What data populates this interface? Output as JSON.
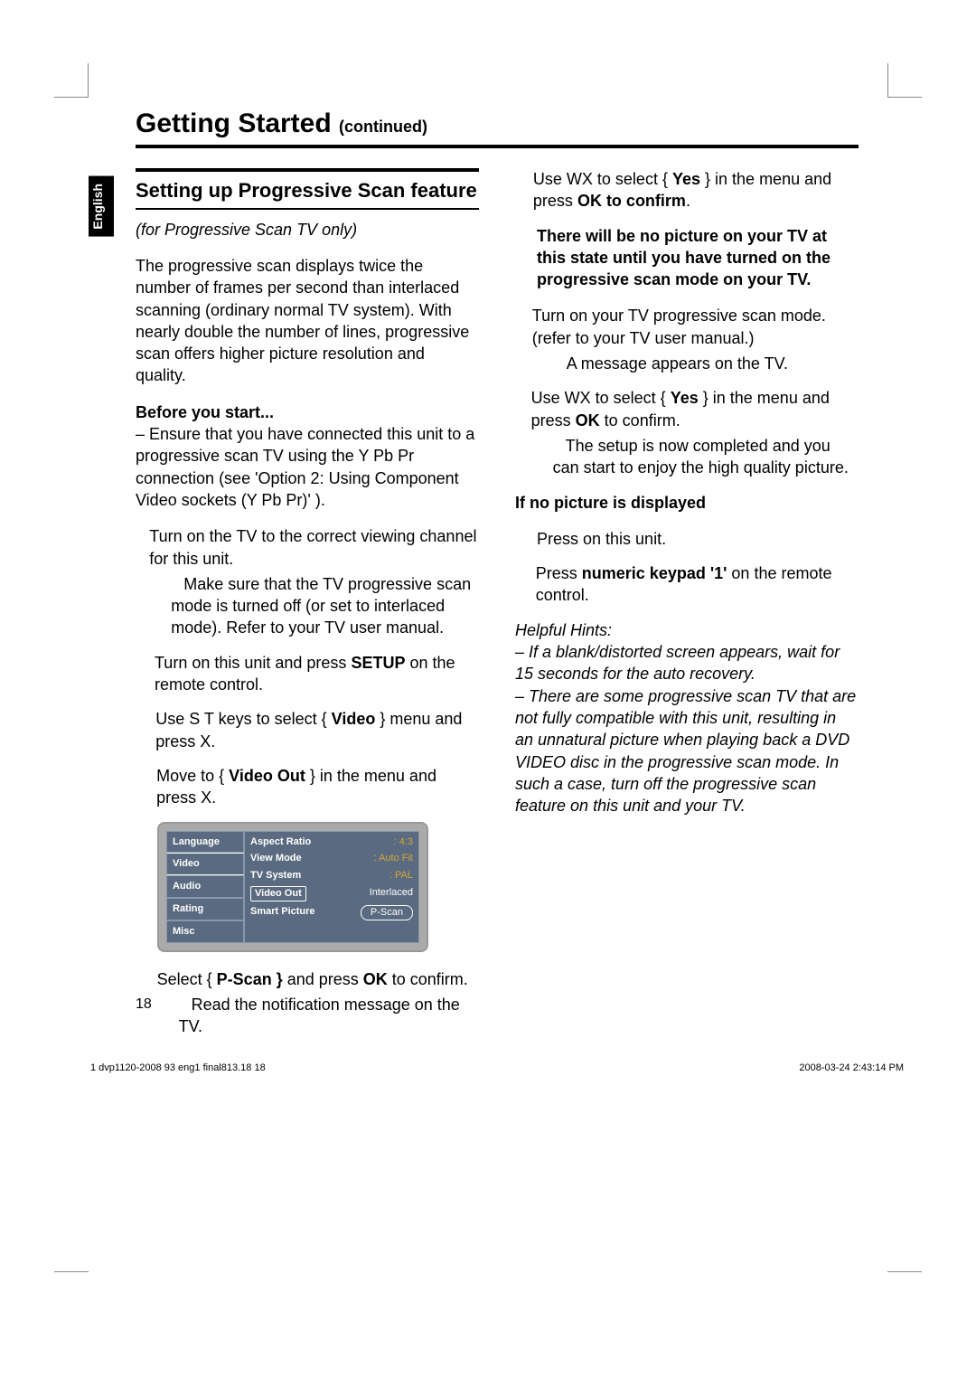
{
  "language_tab": "English",
  "title_main": "Getting Started",
  "title_suffix": "(continued)",
  "section_heading": "Setting up Progressive Scan feature",
  "left": {
    "subtitle_italic": "(for Progressive Scan TV only)",
    "intro": "The progressive scan displays twice the number of frames per second than interlaced scanning (ordinary normal TV system). With nearly double the number of lines, progressive scan offers higher picture resolution and quality.",
    "before_heading": "Before you start...",
    "before_text": "–  Ensure that you have connected this unit to a progressive scan TV using the Y Pb Pr connection (see 'Option 2: Using Component Video sockets (Y Pb Pr)' ).",
    "step1a": "Turn on the TV to the correct viewing channel for this unit.",
    "step1b": "Make sure that the TV progressive scan mode is turned off (or set to interlaced mode). Refer to your TV user manual.",
    "step2_pre": "Turn on this unit and press ",
    "step2_bold": "SETUP",
    "step2_post": " on the remote control.",
    "step3_pre": "Use  S T  keys to select { ",
    "step3_bold": "Video",
    "step3_post": " } menu and press  X.",
    "step4_pre": "Move to { ",
    "step4_bold": "Video Out",
    "step4_post": " } in the menu and press  X.",
    "step5_pre": "Select { ",
    "step5_bold": "P-Scan }",
    "step5_mid": " and press ",
    "step5_bold2": "OK",
    "step5_post": " to confirm.",
    "step5_sub": "Read the notification message on the TV."
  },
  "menu": {
    "left_items": [
      "Language",
      "Video",
      "Audio",
      "Rating",
      "Misc"
    ],
    "rows": [
      {
        "k": "Aspect Ratio",
        "v": ": 4:3",
        "cls": "v"
      },
      {
        "k": "View Mode",
        "v": ": Auto Fit",
        "cls": "v"
      },
      {
        "k": "TV System",
        "v": ": PAL",
        "cls": "v"
      },
      {
        "k": "Video Out",
        "v": "Interlaced",
        "cls": "plain",
        "box": true
      },
      {
        "k": "Smart Picture",
        "v": "P-Scan",
        "cls": "pill"
      }
    ]
  },
  "right": {
    "step6_pre": "Use  WX to select { ",
    "step6_bold": "Yes",
    "step6_mid": " } in the menu and press ",
    "step6_bold2": "OK to confirm",
    "step6_post": ".",
    "warn": "There will be no picture on your TV at this state until you have turned on the progressive scan mode on your TV.",
    "step7a": "Turn on your TV progressive scan mode. (refer to your TV user manual.)",
    "step7b": "A message appears on the TV.",
    "step8_pre": "Use  WX to select { ",
    "step8_bold": "Yes",
    "step8_mid": " } in the menu and press ",
    "step8_bold2": "OK",
    "step8_post": " to confirm.",
    "step8_sub": "The setup is now completed and you can start to enjoy the high quality picture.",
    "nopic_heading": "If no picture is displayed",
    "np1": "Press       on this unit.",
    "np2_pre": "Press ",
    "np2_bold": "numeric keypad '1'",
    "np2_post": " on the remote control.",
    "hints_heading": "Helpful Hints:",
    "hint1": "–  If a blank/distorted screen appears, wait for 15 seconds for the auto recovery.",
    "hint2": "–  There are some progressive scan TV that are not fully compatible with this unit, resulting in an unnatural picture when playing back a DVD VIDEO disc in the progressive scan mode. In such a case, turn off the progressive scan feature on this unit and your TV."
  },
  "page_number": "18",
  "footer_left": "1 dvp1120-2008 93 eng1 final813.18   18",
  "footer_right": "2008-03-24   2:43:14 PM"
}
